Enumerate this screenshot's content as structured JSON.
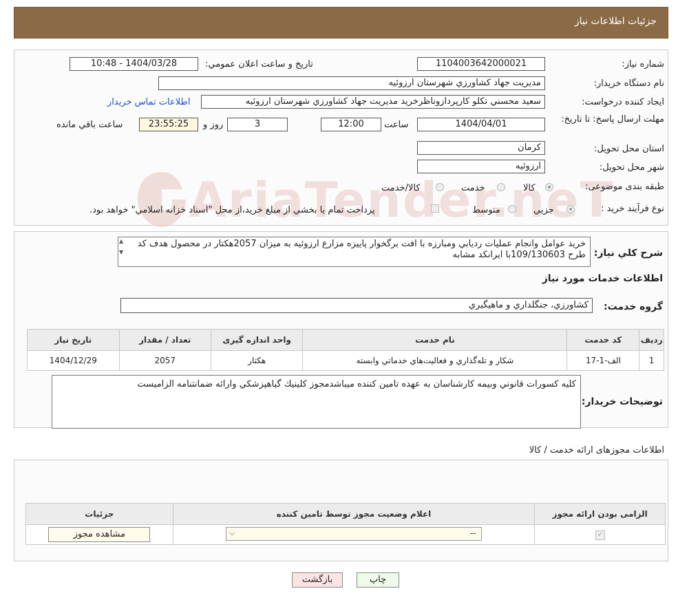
{
  "header": {
    "title": "جزئیات اطلاعات نیاز"
  },
  "form": {
    "need_number_label": "شماره نیاز:",
    "need_number": "1104003642000021",
    "announce_label": "تاریخ و ساعت اعلان عمومي:",
    "announce_value": "1404/03/28 - 10:48",
    "buyer_org_label": "نام دستگاه خريدار:",
    "buyer_org": "مديريت جهاد كشاورزي شهرستان ارزوئيه",
    "creator_label": "ايجاد كننده درخواست:",
    "creator": "سعيد محسني تكلو كارپردازوناظرخريد مديريت جهاد كشاورزي شهرستان ارزوئيه",
    "contact_link": "اطلاعات تماس خريدار",
    "deadline_label": "مهلت ارسال پاسخ: تا تاریخ:",
    "deadline_date": "1404/04/01",
    "time_label": "ساعت",
    "deadline_time": "12:00",
    "days_value": "3",
    "days_label": "روز و",
    "remaining_time": "23:55:25",
    "remaining_label": "ساعت باقي مانده",
    "province_label": "استان محل تحويل:",
    "province": "كرمان",
    "city_label": "شهر محل تحويل:",
    "city": "ارزوئيه",
    "category_label": "طبقه بندی موضوعی:",
    "category_options": [
      "كالا",
      "خدمت",
      "كالا/خدمت"
    ],
    "process_label": "نوع فرآيند خريد :",
    "process_options": [
      "جزيي",
      "متوسط"
    ],
    "process_note": "پرداخت تمام يا بخشي از مبلغ خريد،از محل \"اسناد خزانه اسلامي\" خواهد بود."
  },
  "summary": {
    "label": "شرح كلي نياز:",
    "text": "خريد عوامل وانجام عمليات رديابي ومبارزه با افت برگخوار پاييزه مزارع ارزوئيه به ميزان 2057هكتار در محصول هدف كد طرح 109/130603با ايرانكد مشابه"
  },
  "services": {
    "section_title": "اطلاعات خدمات مورد نياز",
    "group_label": "گروه خدمت:",
    "group_value": "كشاورزي، جنگلداري و ماهيگيري",
    "columns": [
      "رديف",
      "كد خدمت",
      "نام خدمت",
      "واحد اندازه گيری",
      "تعداد / مقدار",
      "تاریخ نیاز"
    ],
    "rows": [
      [
        "1",
        "الف-1-17",
        "شكار و تله‌گذاري و فعاليت‌هاي خدماتي وابسته",
        "هكتار",
        "2057",
        "1404/12/29"
      ]
    ]
  },
  "buyer_notes": {
    "label": "توضيحات خريدار:",
    "text": "كليه كسورات قانوني وبيمه كارشناسان به عهده تامين كننده ميباشدمجوز كلينيك گياهپزشكي وارائه ضمانتنامه الزاميست"
  },
  "permits": {
    "section_title": "اطلاعات مجوزهای ارائه خدمت / كالا",
    "columns": [
      "الزامی بودن ارائه مجوز",
      "اعلام وضعيت مجوز توسط تامين كننده",
      "جزئيات"
    ],
    "select_value": "--",
    "view_button": "مشاهده مجوز"
  },
  "footer": {
    "print_button": "چاپ",
    "back_button": "بازگشت"
  },
  "colors": {
    "header_bg": "#8b6b46",
    "link": "#1a4fd6",
    "back_button_bg": "#fde4e4",
    "print_button_bg": "#eefaea"
  }
}
